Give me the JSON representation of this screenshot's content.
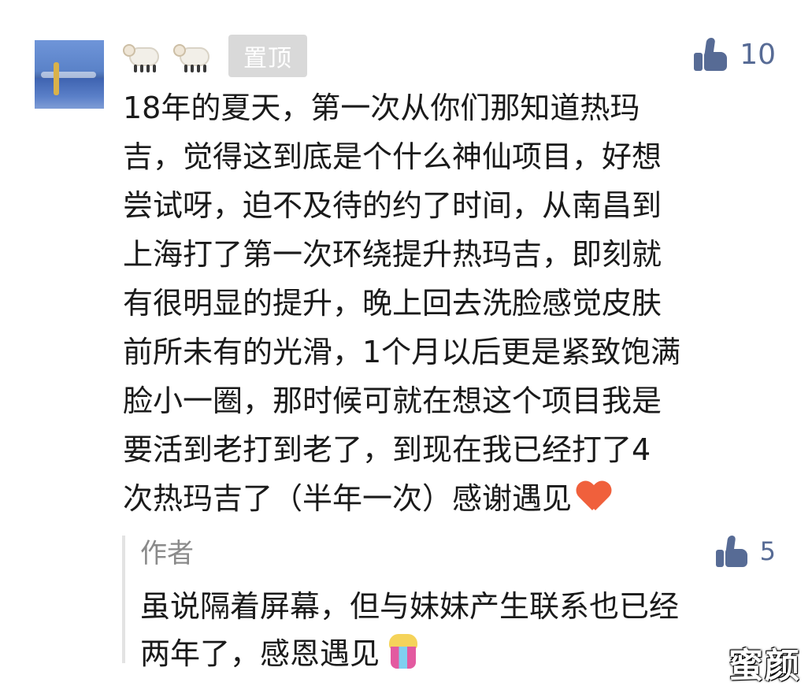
{
  "comment": {
    "pin_badge": "置顶",
    "likes": "10",
    "nickname_icons": [
      "sheep-icon",
      "sheep-icon"
    ],
    "lines": [
      "18年的夏天，第一次从你们那知道热玛",
      "吉，觉得这到底是个什么神仙项目，好想",
      "尝试呀，迫不及待的约了时间，从南昌到",
      "上海打了第一次环绕提升热玛吉，即刻就",
      "有很明显的提升，晚上回去洗脸感觉皮肤",
      "前所未有的光滑，1个月以后更是紧致饱满",
      "脸小一圈，那时候可就在想这个项目我是",
      "要活到老打到老了，到现在我已经打了4",
      "次热玛吉了（半年一次）感谢遇见"
    ],
    "end_icon": "heart-icon"
  },
  "reply": {
    "author": "作者",
    "likes": "5",
    "lines": [
      "虽说隔着屏幕，但与妹妹产生联系也已经",
      "两年了，感恩遇见"
    ],
    "end_icon": "popcorn-icon"
  },
  "watermark": "蜜颜",
  "colors": {
    "link_blue": "#576b95",
    "badge_gray": "#d9d9d9",
    "reply_gray": "#8a8a8a",
    "heart": "#f0603c"
  }
}
